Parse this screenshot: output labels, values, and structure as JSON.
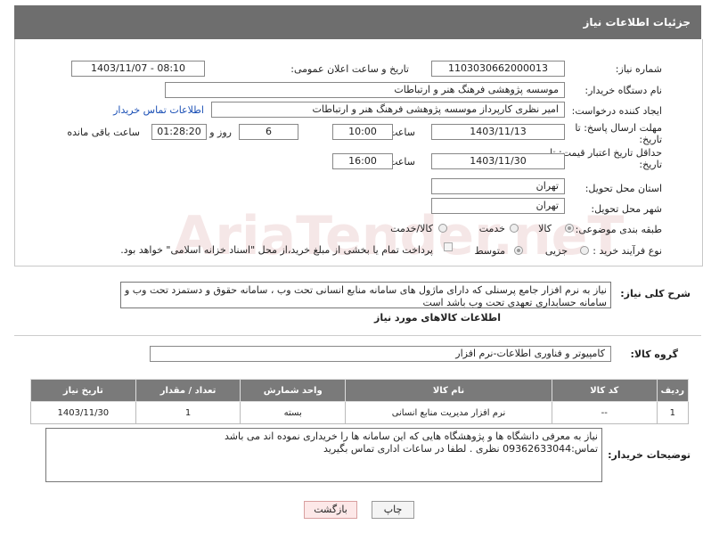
{
  "header": {
    "title": "جزئیات اطلاعات نیاز"
  },
  "fields": {
    "need_number_label": "شماره نیاز:",
    "need_number": "1103030662000013",
    "announce_label": "تاریخ و ساعت اعلان عمومی:",
    "announce_value": "1403/11/07 - 08:10",
    "buyer_label": "نام دستگاه خریدار:",
    "buyer_value": "موسسه پژوهشی فرهنگ  هنر و ارتباطات",
    "creator_label": "ایجاد کننده درخواست:",
    "creator_value": "امیر نظری کارپرداز موسسه پژوهشی فرهنگ  هنر و ارتباطات",
    "contact_link": "اطلاعات تماس خریدار",
    "deadline_label": "مهلت ارسال پاسخ: تا تاریخ:",
    "deadline_date": "1403/11/13",
    "time_label": "ساعت",
    "deadline_time": "10:00",
    "days_value": "6",
    "days_label": "روز و",
    "remaining_value": "01:28:20",
    "remaining_label": "ساعت باقی مانده",
    "validity_label": "حداقل تاریخ اعتبار قیمت: تا تاریخ:",
    "validity_date": "1403/11/30",
    "validity_time": "16:00",
    "province_label": "استان محل تحویل:",
    "province_value": "تهران",
    "city_label": "شهر محل تحویل:",
    "city_value": "تهران",
    "category_label": "طبقه بندی موضوعی:",
    "category_options": [
      "کالا",
      "خدمت",
      "کالا/خدمت"
    ],
    "process_label": "نوع فرآیند خرید :",
    "process_options": [
      "جزیی",
      "متوسط"
    ],
    "payment_text": "پرداخت تمام یا بخشی از مبلغ خرید،از محل \"اسناد خزانه اسلامی\" خواهد بود."
  },
  "description": {
    "label": "شرح کلی نیاز:",
    "text": "نیاز به نرم افزار جامع پرسنلی که دارای ماژول های سامانه منابع انسانی تحت وب ، سامانه حقوق و دستمزد تحت وب و سامانه حسابداری تعهدی تحت وب باشد است"
  },
  "goods": {
    "section_title": "اطلاعات کالاهای مورد نیاز",
    "group_label": "گروه کالا:",
    "group_value": "کامپیوتر و فناوری اطلاعات-نرم افزار",
    "columns": [
      "ردیف",
      "کد کالا",
      "نام کالا",
      "واحد شمارش",
      "تعداد / مقدار",
      "تاریخ نیاز"
    ],
    "rows": [
      [
        "1",
        "--",
        "نرم افزار مدیریت منابع انسانی",
        "بسته",
        "1",
        "1403/11/30"
      ]
    ]
  },
  "buyer_notes": {
    "label": "توضیحات خریدار:",
    "line1": "نیاز به معرفی دانشگاه ها و پژوهشگاه هایی که این سامانه ها را خریداری نموده اند می باشد",
    "line2": "تماس:09362633044 نظری . لطفا در ساعات اداری تماس بگیرید"
  },
  "buttons": {
    "print": "چاپ",
    "back": "بازگشت"
  },
  "watermark": "AriaTender.neT",
  "colors": {
    "header_bg": "#6e6e6e",
    "link": "#1a4fb5",
    "back_button_bg": "#fde8e8"
  }
}
